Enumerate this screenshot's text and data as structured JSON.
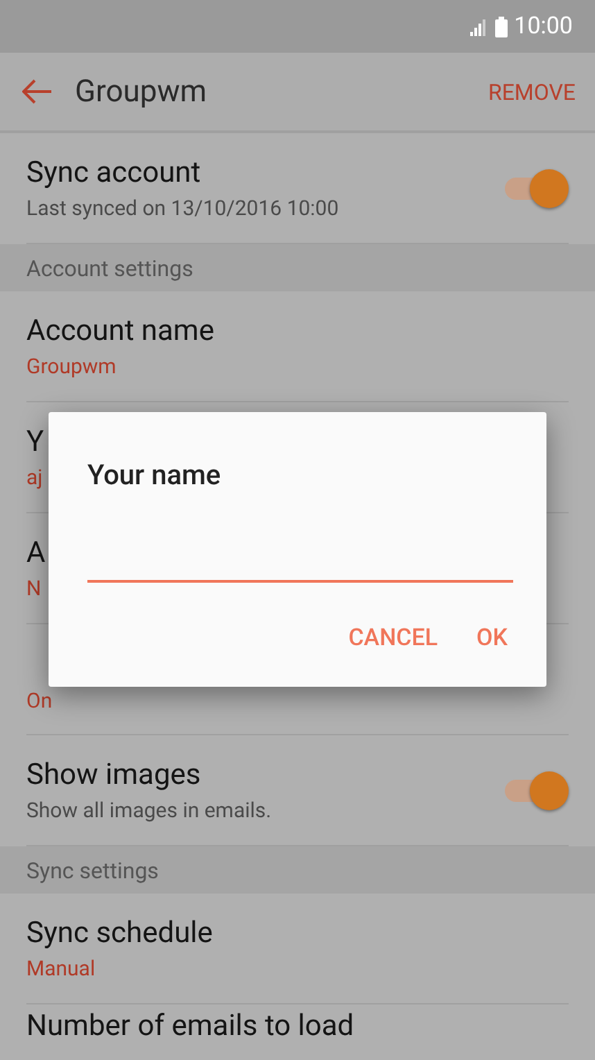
{
  "status_bar": {
    "time": "10:00"
  },
  "toolbar": {
    "title": "Groupwm",
    "action": "REMOVE"
  },
  "list": [
    {
      "kind": "switch",
      "title": "Sync account",
      "subtitle": "Last synced on 13/10/2016  10:00",
      "on": true
    },
    {
      "kind": "header",
      "title": "Account settings"
    },
    {
      "kind": "value",
      "title": "Account name",
      "value": "Groupwm"
    },
    {
      "kind": "value",
      "title": "Y",
      "value": "aj"
    },
    {
      "kind": "value",
      "title": "A",
      "value": "N"
    },
    {
      "kind": "covered",
      "value": "On"
    },
    {
      "kind": "switch",
      "title": "Show images",
      "subtitle": "Show all images in emails.",
      "on": true
    },
    {
      "kind": "header",
      "title": "Sync settings"
    },
    {
      "kind": "value",
      "title": "Sync schedule",
      "value": "Manual"
    },
    {
      "kind": "title",
      "title": "Number of emails to load"
    }
  ],
  "dialog": {
    "title": "Your name",
    "buttons": [
      "CANCEL",
      "OK"
    ]
  }
}
